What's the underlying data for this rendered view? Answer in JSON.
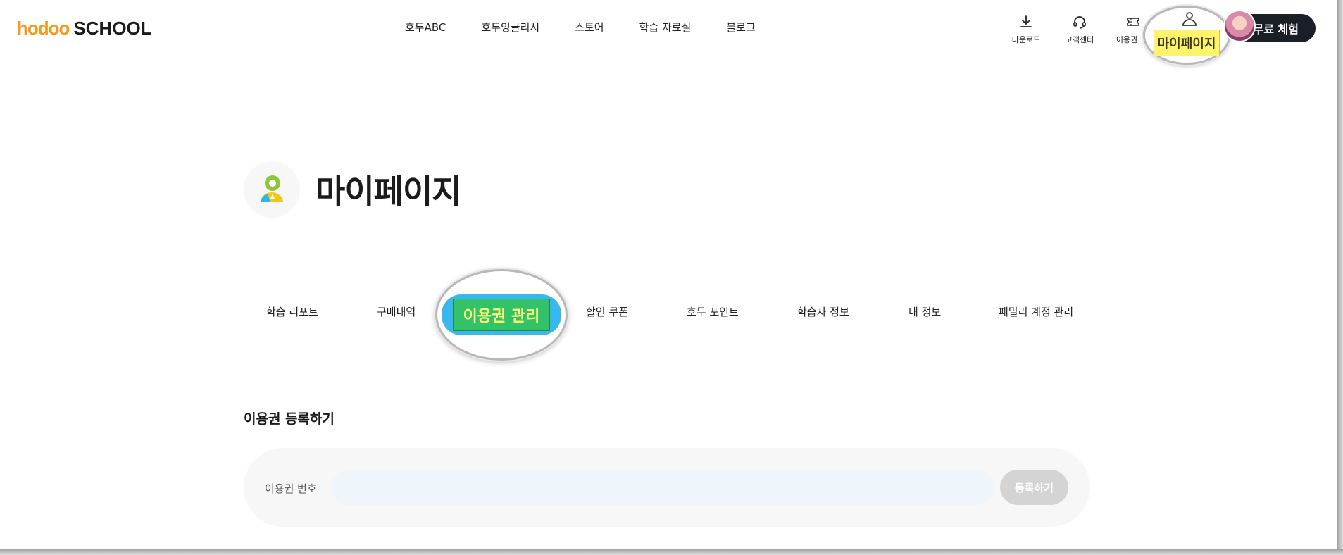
{
  "header": {
    "logo_hodoo": "hodoo",
    "logo_school": "SCHOOL",
    "nav": [
      "호두ABC",
      "호두잉글리시",
      "스토어",
      "학습 자료실",
      "블로그"
    ],
    "utils": [
      {
        "label": "다운로드",
        "icon": "download-icon"
      },
      {
        "label": "고객센터",
        "icon": "headset-icon"
      },
      {
        "label": "이용권",
        "icon": "ticket-icon"
      }
    ],
    "mypage_label": "마이페이지",
    "free_trial_label": "무료 체험"
  },
  "page": {
    "title": "마이페이지"
  },
  "tabs": [
    {
      "label": "학습 리포트",
      "active": false
    },
    {
      "label": "구매내역",
      "active": false
    },
    {
      "label": "이용권 관리",
      "active": true
    },
    {
      "label": "할인 쿠폰",
      "active": false
    },
    {
      "label": "호두 포인트",
      "active": false
    },
    {
      "label": "학습자 정보",
      "active": false
    },
    {
      "label": "내 정보",
      "active": false
    },
    {
      "label": "패밀리 계정 관리",
      "active": false
    }
  ],
  "register": {
    "section_title": "이용권 등록하기",
    "field_label": "이용권 번호",
    "input_value": "",
    "input_placeholder": "",
    "button_label": "등록하기"
  },
  "colors": {
    "brand_orange": "#f39a1c",
    "dark": "#1a1f27",
    "active_tab_blue": "#38b8ee",
    "highlight_yellow": "#fff36b"
  }
}
